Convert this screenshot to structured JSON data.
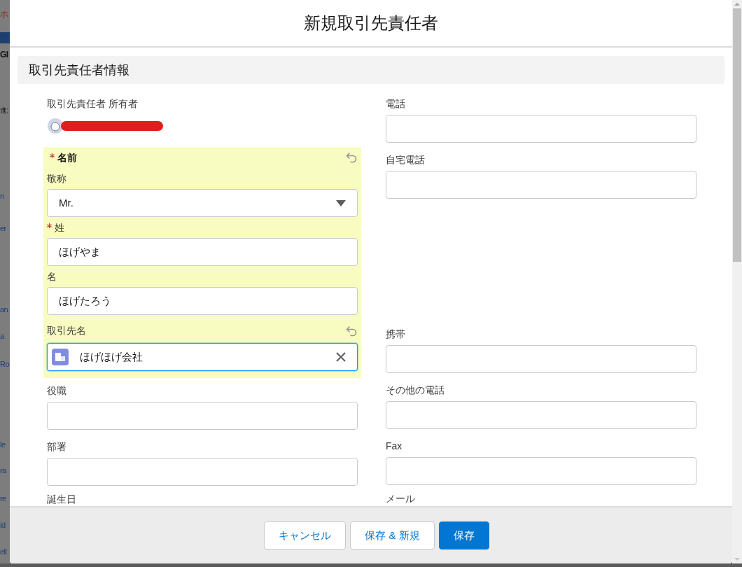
{
  "background_fragments": [
    {
      "text": "ホ",
      "kind": "heading"
    },
    {
      "text": "GI",
      "kind": "title"
    },
    {
      "text": "進:",
      "kind": "label"
    },
    {
      "text": "n",
      "kind": "link"
    },
    {
      "text": "er",
      "kind": "link"
    },
    {
      "text": "an",
      "kind": "link"
    },
    {
      "text": "a",
      "kind": "link"
    },
    {
      "text": "Ro",
      "kind": "link"
    },
    {
      "text": "le",
      "kind": "link"
    },
    {
      "text": "ra",
      "kind": "link"
    },
    {
      "text": "re",
      "kind": "link"
    },
    {
      "text": "id",
      "kind": "link"
    },
    {
      "text": "ell",
      "kind": "link"
    }
  ],
  "modal": {
    "title": "新規取引先責任者",
    "section": "取引先責任者情報"
  },
  "left_fields": [
    {
      "kind": "owner",
      "label": "取引先責任者 所有者"
    },
    {
      "kind": "name_group",
      "label": "名前",
      "required": true,
      "edited": true,
      "subfields": [
        {
          "kind": "select",
          "label": "敬称",
          "value": "Mr.",
          "required": false
        },
        {
          "kind": "text",
          "label": "姓",
          "value": "ほげやま",
          "required": true
        },
        {
          "kind": "text",
          "label": "名",
          "value": "ほげたろう",
          "required": false
        }
      ],
      "lookup": {
        "label": "取引先名",
        "value": "ほげほげ会社",
        "focused": true
      }
    },
    {
      "kind": "text",
      "label": "役職"
    },
    {
      "kind": "text",
      "label": "部署"
    },
    {
      "kind": "label_only",
      "label": "誕生日"
    }
  ],
  "right_fields": [
    {
      "kind": "text",
      "label": "電話"
    },
    {
      "kind": "text",
      "label": "自宅電話"
    },
    {
      "kind": "text",
      "label": "携帯"
    },
    {
      "kind": "text",
      "label": "その他の電話"
    },
    {
      "kind": "text",
      "label": "Fax"
    },
    {
      "kind": "label_only",
      "label": "メール"
    }
  ],
  "buttons": [
    {
      "label": "キャンセル",
      "kind": "neutral"
    },
    {
      "label": "保存 & 新規",
      "kind": "neutral"
    },
    {
      "label": "保存",
      "kind": "brand"
    }
  ]
}
